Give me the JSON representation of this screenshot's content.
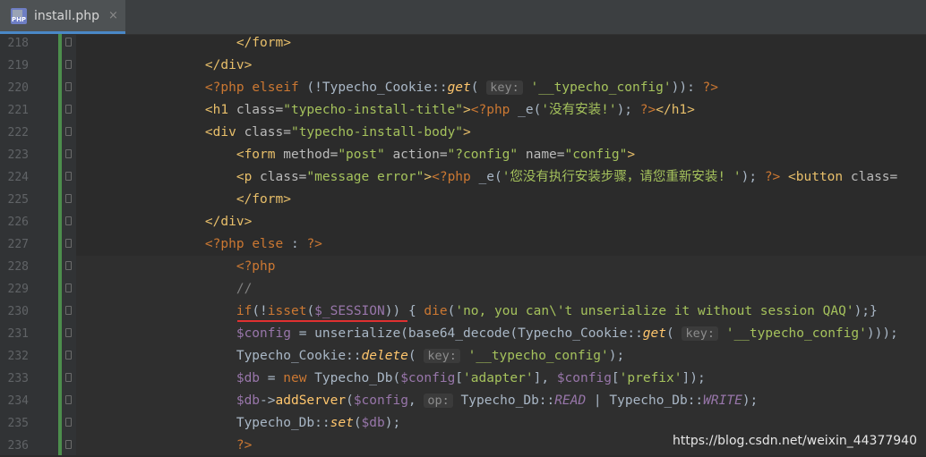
{
  "tab": {
    "icon_label": "PHP",
    "title": "install.php",
    "close": "×"
  },
  "lines": [
    {
      "n": "218",
      "parts": [
        [
          "tag",
          "        </form>"
        ]
      ]
    },
    {
      "n": "219",
      "parts": [
        [
          "tag",
          "    </div>"
        ]
      ]
    },
    {
      "n": "220",
      "parts": [
        [
          "php",
          "    <?php "
        ],
        [
          "kw",
          "elseif "
        ],
        [
          "txt",
          "(!Typecho_Cookie::"
        ],
        [
          "ital",
          "get"
        ],
        [
          "txt",
          "( "
        ],
        [
          "hint",
          "key:"
        ],
        [
          "txt",
          " "
        ],
        [
          "str",
          "'__typecho_config'"
        ],
        [
          "txt",
          ")): "
        ],
        [
          "php",
          "?>"
        ]
      ]
    },
    {
      "n": "221",
      "parts": [
        [
          "tag",
          "    <h1 "
        ],
        [
          "attr",
          "class="
        ],
        [
          "str",
          "\"typecho-install-title\""
        ],
        [
          "tag",
          ">"
        ],
        [
          "php",
          "<?php "
        ],
        [
          "txt",
          "_e("
        ],
        [
          "str",
          "'没有安装!'"
        ],
        [
          "txt",
          "); "
        ],
        [
          "php",
          "?>"
        ],
        [
          "tag",
          "</h1>"
        ]
      ]
    },
    {
      "n": "222",
      "parts": [
        [
          "tag",
          "    <div "
        ],
        [
          "attr",
          "class="
        ],
        [
          "str",
          "\"typecho-install-body\""
        ],
        [
          "tag",
          ">"
        ]
      ]
    },
    {
      "n": "223",
      "parts": [
        [
          "tag",
          "        <form "
        ],
        [
          "attr",
          "method="
        ],
        [
          "str",
          "\"post\" "
        ],
        [
          "attr",
          "action="
        ],
        [
          "str",
          "\"?config\" "
        ],
        [
          "attr",
          "name="
        ],
        [
          "str",
          "\"config\""
        ],
        [
          "tag",
          ">"
        ]
      ]
    },
    {
      "n": "224",
      "parts": [
        [
          "tag",
          "        <p "
        ],
        [
          "attr",
          "class="
        ],
        [
          "str",
          "\"message error\""
        ],
        [
          "tag",
          ">"
        ],
        [
          "php",
          "<?php "
        ],
        [
          "txt",
          "_e("
        ],
        [
          "str",
          "'您没有执行安装步骤，请您重新安装! '"
        ],
        [
          "txt",
          "); "
        ],
        [
          "php",
          "?> "
        ],
        [
          "tag",
          "<button "
        ],
        [
          "attr",
          "class="
        ]
      ]
    },
    {
      "n": "225",
      "parts": [
        [
          "tag",
          "        </form>"
        ]
      ]
    },
    {
      "n": "226",
      "parts": [
        [
          "tag",
          "    </div>"
        ]
      ]
    },
    {
      "n": "227",
      "parts": [
        [
          "php",
          "    <?php "
        ],
        [
          "kw",
          "else "
        ],
        [
          "txt",
          ": "
        ],
        [
          "php",
          "?>"
        ]
      ]
    },
    {
      "n": "228",
      "parts": [
        [
          "php",
          "        <?php"
        ]
      ]
    },
    {
      "n": "229",
      "parts": [
        [
          "comment",
          "        //"
        ]
      ]
    },
    {
      "n": "230",
      "parts": [
        [
          "kw",
          "        if"
        ],
        [
          "txt",
          "(!"
        ],
        [
          "kw",
          "isset"
        ],
        [
          "txt",
          "("
        ],
        [
          "var",
          "$_SESSION"
        ],
        [
          "txt",
          ")) { "
        ],
        [
          "kw",
          "die"
        ],
        [
          "txt",
          "("
        ],
        [
          "str",
          "'no, you can\\'t unserialize it without session QAQ'"
        ],
        [
          "txt",
          ");}"
        ]
      ]
    },
    {
      "n": "231",
      "parts": [
        [
          "var",
          "        $config "
        ],
        [
          "txt",
          "= unserialize(base64_decode(Typecho_Cookie::"
        ],
        [
          "ital",
          "get"
        ],
        [
          "txt",
          "( "
        ],
        [
          "hint",
          "key:"
        ],
        [
          "txt",
          " "
        ],
        [
          "str",
          "'__typecho_config'"
        ],
        [
          "txt",
          ")));"
        ]
      ]
    },
    {
      "n": "232",
      "parts": [
        [
          "txt",
          "        Typecho_Cookie::"
        ],
        [
          "ital",
          "delete"
        ],
        [
          "txt",
          "( "
        ],
        [
          "hint",
          "key:"
        ],
        [
          "txt",
          " "
        ],
        [
          "str",
          "'__typecho_config'"
        ],
        [
          "txt",
          ");"
        ]
      ]
    },
    {
      "n": "233",
      "parts": [
        [
          "var",
          "        $db "
        ],
        [
          "txt",
          "= "
        ],
        [
          "kw",
          "new "
        ],
        [
          "txt",
          "Typecho_Db("
        ],
        [
          "var",
          "$config"
        ],
        [
          "txt",
          "["
        ],
        [
          "str",
          "'adapter'"
        ],
        [
          "txt",
          "], "
        ],
        [
          "var",
          "$config"
        ],
        [
          "txt",
          "["
        ],
        [
          "str",
          "'prefix'"
        ],
        [
          "txt",
          "]);"
        ]
      ]
    },
    {
      "n": "234",
      "parts": [
        [
          "var",
          "        $db"
        ],
        [
          "txt",
          "->"
        ],
        [
          "fn",
          "addServer"
        ],
        [
          "txt",
          "("
        ],
        [
          "var",
          "$config"
        ],
        [
          "txt",
          ", "
        ],
        [
          "hint",
          "op:"
        ],
        [
          "txt",
          " Typecho_Db::"
        ],
        [
          "const",
          "READ"
        ],
        [
          "txt",
          " | Typecho_Db::"
        ],
        [
          "const",
          "WRITE"
        ],
        [
          "txt",
          ");"
        ]
      ]
    },
    {
      "n": "235",
      "parts": [
        [
          "txt",
          "        Typecho_Db::"
        ],
        [
          "ital",
          "set"
        ],
        [
          "txt",
          "("
        ],
        [
          "var",
          "$db"
        ],
        [
          "txt",
          ");"
        ]
      ]
    },
    {
      "n": "236",
      "parts": [
        [
          "php",
          "        ?>"
        ]
      ]
    }
  ],
  "watermark": "https://blog.csdn.net/weixin_44377940"
}
